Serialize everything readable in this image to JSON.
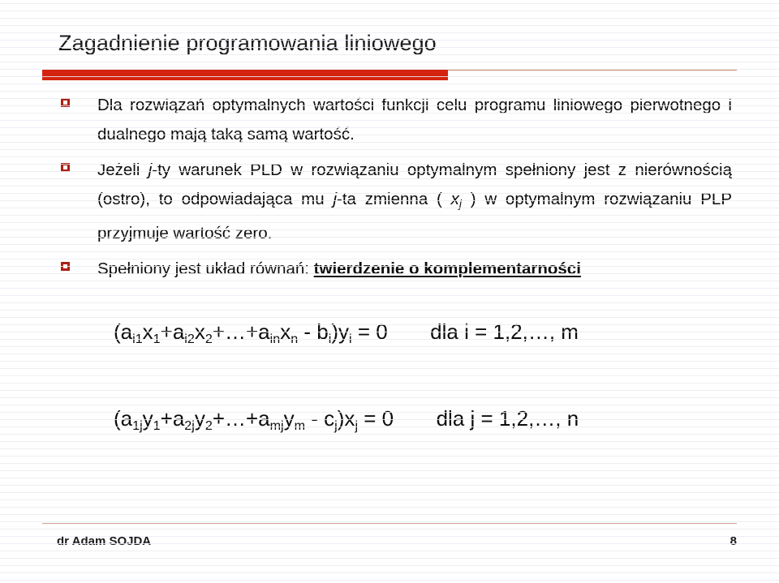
{
  "slide": {
    "title": "Zagadnienie programowania liniowego",
    "accent_color": "#d42410",
    "rule_thin_color": "#c98468",
    "bullet_marker_color": "#ad2014",
    "bullet_icon": "hollow-square-bullet"
  },
  "bullets": [
    {
      "id": "bullet-1",
      "parts": [
        {
          "text": "Dla rozwiązań optymalnych wartości funkcji celu programu liniowego pierwotnego i dualnego mają taką samą wartość.",
          "style": "normal"
        }
      ],
      "plain": "Dla rozwiązań optymalnych wartości funkcji celu programu liniowego pierwotnego i dualnego mają taką samą wartość."
    },
    {
      "id": "bullet-2",
      "parts": [
        {
          "text": "Jeżeli ",
          "style": "normal"
        },
        {
          "text": "j",
          "style": "italic"
        },
        {
          "text": "-ty warunek PLD w rozwiązaniu optymalnym spełniony jest z nierównością (ostro), to odpowiadająca mu ",
          "style": "normal"
        },
        {
          "text": "j",
          "style": "italic"
        },
        {
          "text": "-ta zmienna ( ",
          "style": "normal"
        },
        {
          "text": "x",
          "style": "italic"
        },
        {
          "text": "j",
          "style": "italic-sub"
        },
        {
          "text": " ) w optymalnym rozwiązaniu PLP przyjmuje wartość zero.",
          "style": "normal"
        }
      ],
      "plain": "Jeżeli j-ty warunek PLD w rozwiązaniu optymalnym spełniony jest z nierównością (ostro), to odpowiadająca mu j-ta zmienna ( xj ) w optymalnym rozwiązaniu PLP przyjmuje wartość zero."
    },
    {
      "id": "bullet-3",
      "parts": [
        {
          "text": "Spełniony jest układ równań: ",
          "style": "normal"
        },
        {
          "text": "twierdzenie o komplementarności",
          "style": "bold-underline"
        }
      ],
      "plain": "Spełniony jest układ równań: twierdzenie o komplementarności"
    }
  ],
  "equations": [
    {
      "id": "equation-1",
      "lhs_tokens": [
        "(a",
        "i1",
        "x",
        "1",
        "+a",
        "i2",
        "x",
        "2",
        "+…+a",
        "in",
        "x",
        "n",
        " - b",
        "i",
        ")y",
        "i",
        " = 0"
      ],
      "plain": "(ai1x1+ai2x2+…+ainxn - bi)yi = 0",
      "condition": "dla i = 1,2,…, m"
    },
    {
      "id": "equation-2",
      "lhs_tokens": [
        "(a",
        "1j",
        "y",
        "1",
        "+a",
        "2j",
        "y",
        "2",
        "+…+a",
        "mj",
        "y",
        "m",
        " - c",
        "j",
        ")x",
        "j",
        " = 0"
      ],
      "plain": "(a1jy1+a2jy2+…+amjym - cj)xj = 0",
      "condition": "dla j = 1,2,…, n"
    }
  ],
  "footer": {
    "author": "dr Adam SOJDA",
    "page_number": "8"
  }
}
